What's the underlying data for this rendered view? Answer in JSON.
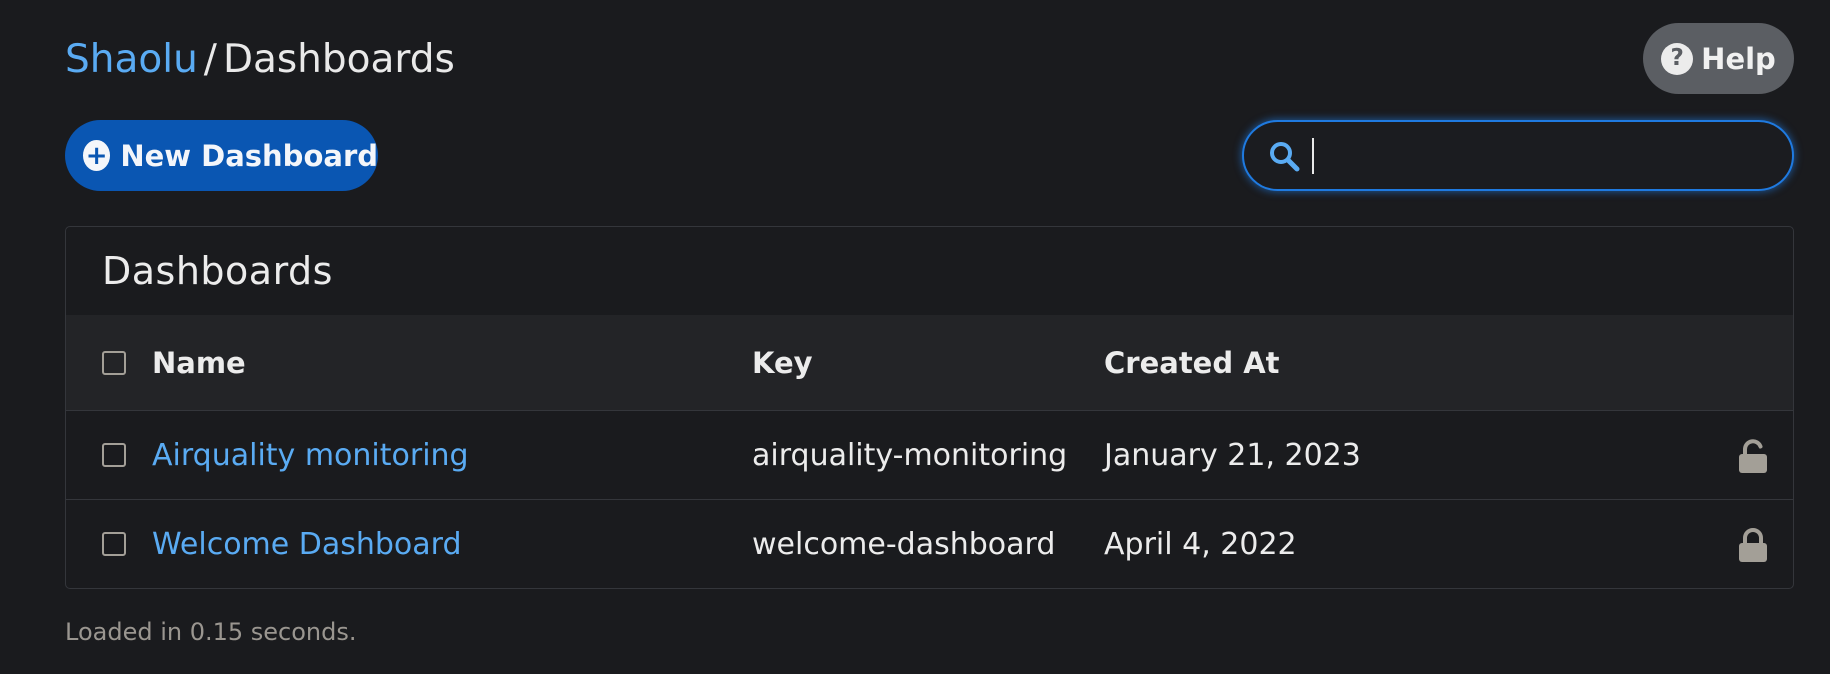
{
  "breadcrumb": {
    "org": "Shaolu",
    "separator": "/",
    "current": "Dashboards"
  },
  "help_button": {
    "label": "Help",
    "icon": "question-circle-icon"
  },
  "new_dashboard_button": {
    "label": "New Dashboard",
    "icon": "plus-circle-icon"
  },
  "search": {
    "value": "",
    "placeholder": "",
    "icon": "search-icon"
  },
  "card": {
    "title": "Dashboards",
    "columns": {
      "name": "Name",
      "key": "Key",
      "created_at": "Created At"
    },
    "rows": [
      {
        "name": "Airquality monitoring",
        "key": "airquality-monitoring",
        "created_at": "January 21, 2023",
        "lock": "unlocked-icon"
      },
      {
        "name": "Welcome Dashboard",
        "key": "welcome-dashboard",
        "created_at": "April 4, 2022",
        "lock": "locked-icon"
      }
    ]
  },
  "footer": {
    "load_time": "Loaded in 0.15 seconds."
  },
  "colors": {
    "background": "#1a1b1e",
    "link": "#5aabf3",
    "primary": "#0a56b2",
    "focus_ring": "#1f7ae0",
    "muted": "#9a9690"
  }
}
